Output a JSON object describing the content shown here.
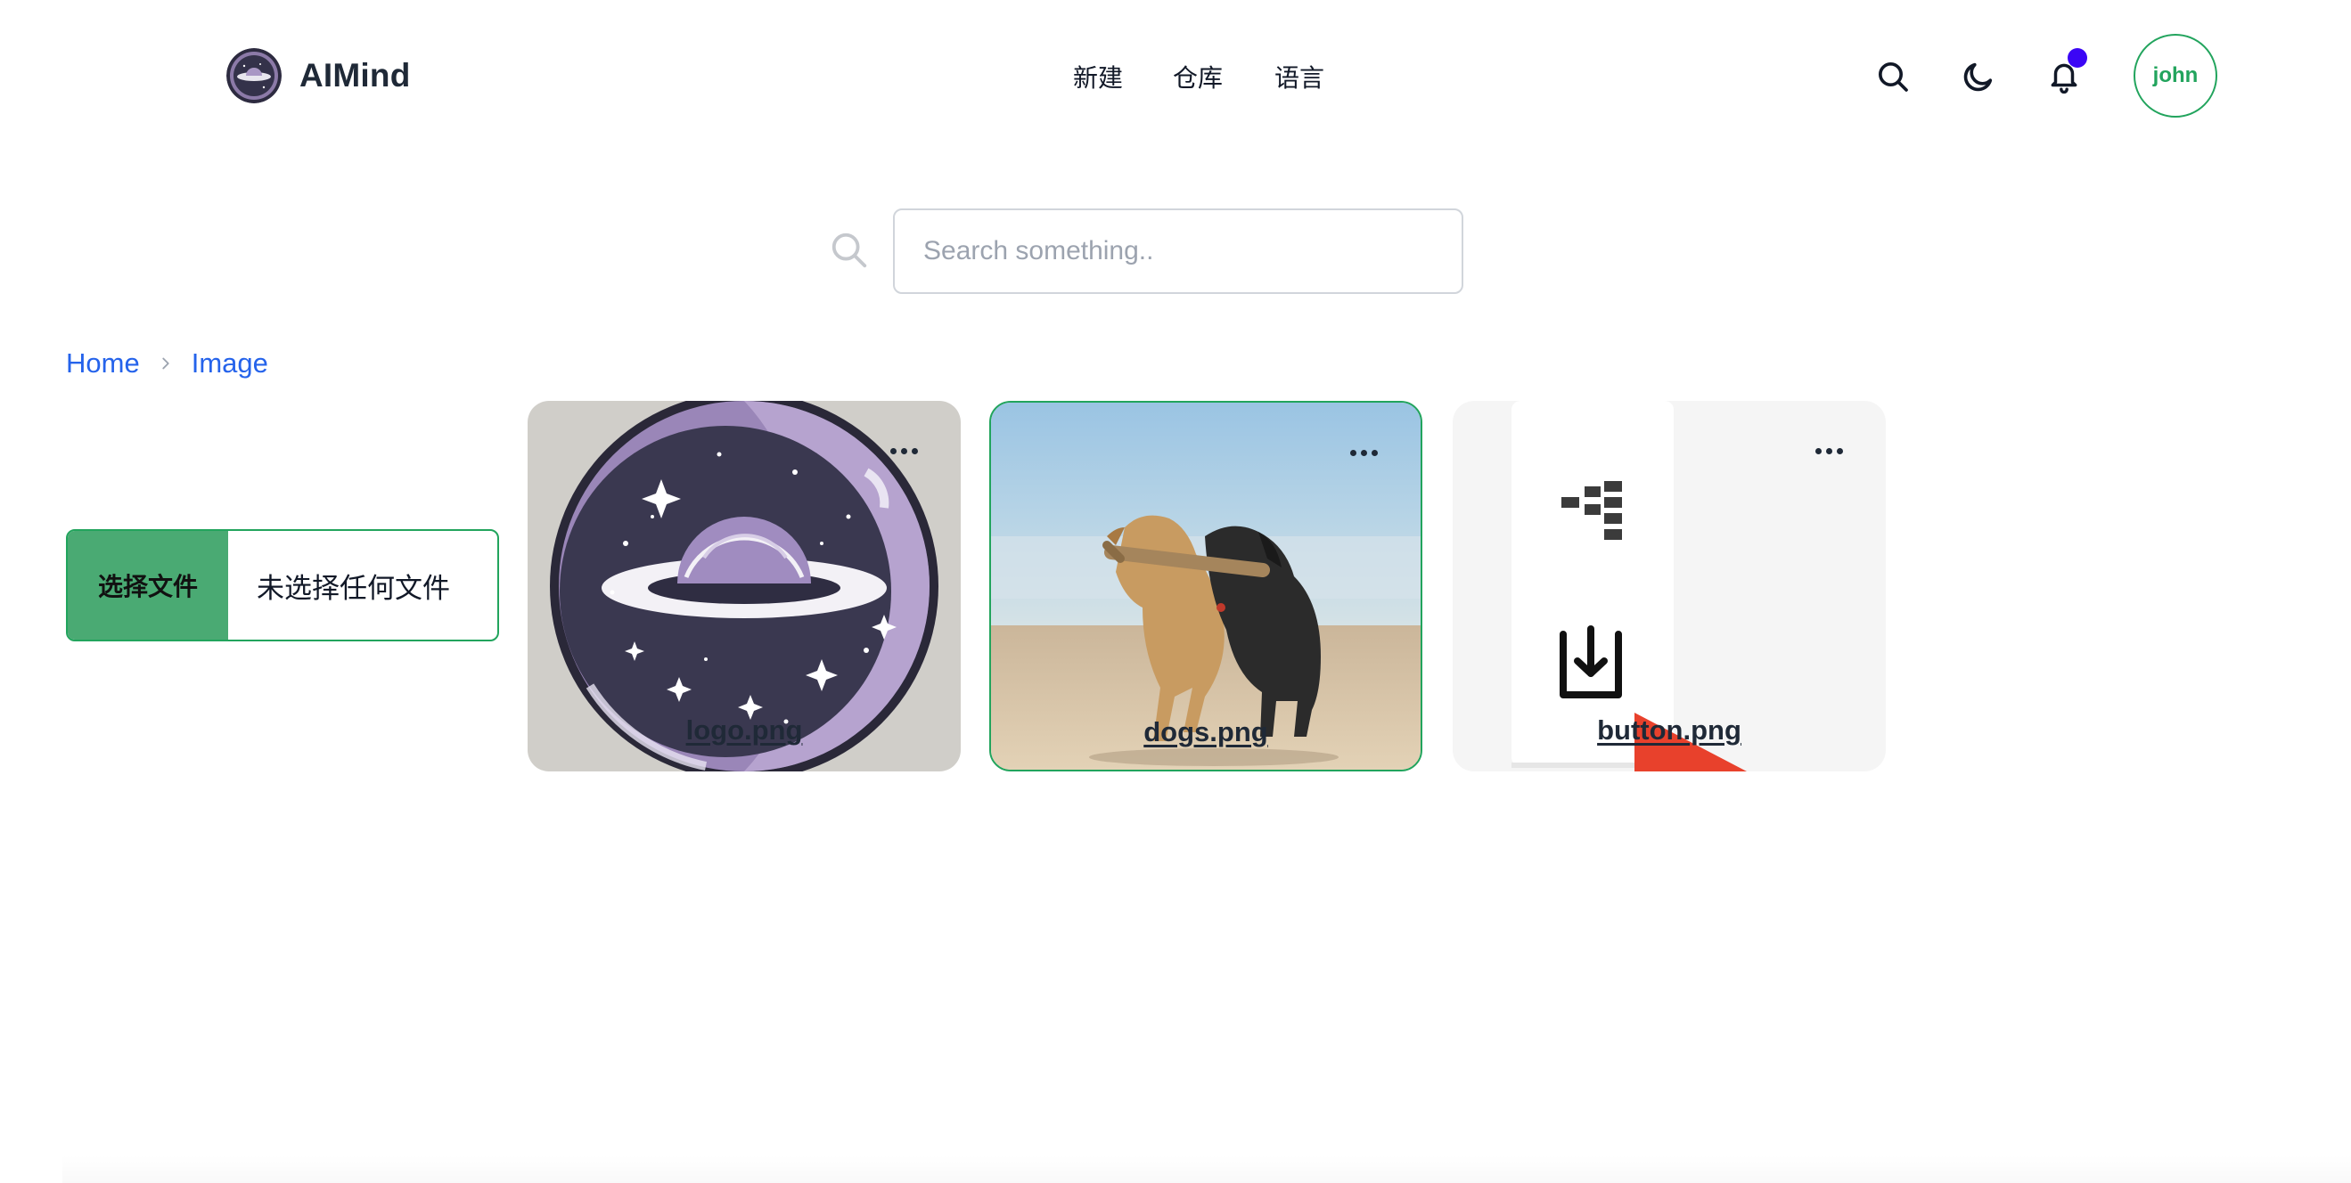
{
  "header": {
    "brand_name": "AIMind",
    "nav": [
      "新建",
      "仓库",
      "语言"
    ],
    "avatar_text": "john",
    "icons": [
      "search-icon",
      "moon-icon",
      "bell-icon"
    ],
    "notification_dot_color": "#3b06f5",
    "accent_color": "#22a45d"
  },
  "search": {
    "placeholder": "Search something.."
  },
  "breadcrumb": {
    "items": [
      "Home",
      "Image"
    ]
  },
  "upload": {
    "button_label": "选择文件",
    "status": "未选择任何文件"
  },
  "cards": [
    {
      "name": "logo.png"
    },
    {
      "name": "dogs.png"
    },
    {
      "name": "button.png"
    }
  ]
}
